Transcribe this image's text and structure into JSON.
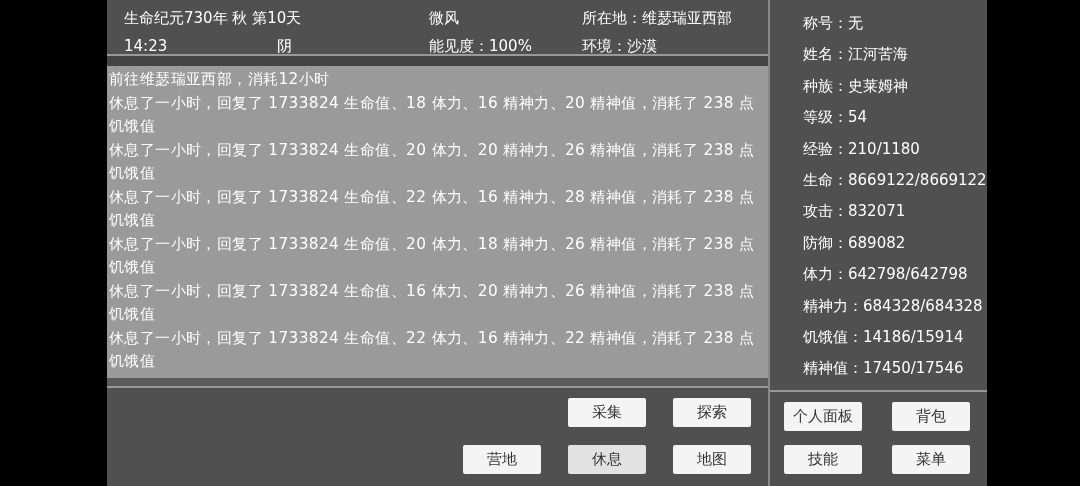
{
  "header": {
    "date": "生命纪元730年 秋 第10天",
    "time": "14:23",
    "weather": "阴",
    "wind": "微风",
    "visibility": "能见度：100%",
    "location": "所在地：维瑟瑞亚西部",
    "environment": "环境：沙漠"
  },
  "log": [
    "前往维瑟瑞亚西部，消耗12小时",
    "休息了一小时，回复了 1733824 生命值、18 体力、16 精神力、20 精神值，消耗了 238 点饥饿值",
    "休息了一小时，回复了 1733824 生命值、20 体力、20 精神力、26 精神值，消耗了 238 点饥饿值",
    "休息了一小时，回复了 1733824 生命值、22 体力、16 精神力、28 精神值，消耗了 238 点饥饿值",
    "休息了一小时，回复了 1733824 生命值、20 体力、18 精神力、26 精神值，消耗了 238 点饥饿值",
    "休息了一小时，回复了 1733824 生命值、16 体力、20 精神力、26 精神值，消耗了 238 点饥饿值",
    "休息了一小时，回复了 1733824 生命值、22 体力、16 精神力、22 精神值，消耗了 238 点饥饿值"
  ],
  "actions": [
    {
      "label": "采集",
      "selected": false
    },
    {
      "label": "探索",
      "selected": false
    },
    {
      "label": "营地",
      "selected": false
    },
    {
      "label": "休息",
      "selected": true
    },
    {
      "label": "地图",
      "selected": false
    }
  ],
  "stats": [
    "称号：无",
    "姓名：江河苦海",
    "种族：史莱姆神",
    "等级：54",
    "经验：210/1180",
    "生命：8669122/8669122",
    "攻击：832071",
    "防御：689082",
    "体力：642798/642798",
    "精神力：684328/684328",
    "饥饿值：14186/15914",
    "精神值：17450/17546"
  ],
  "menu_buttons": [
    "个人面板",
    "背包",
    "技能",
    "菜单"
  ]
}
